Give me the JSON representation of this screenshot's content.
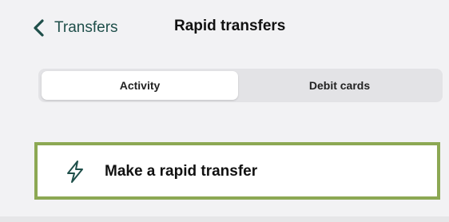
{
  "nav": {
    "back_label": "Transfers",
    "back_icon": "chevron-left-icon",
    "title": "Rapid transfers"
  },
  "tabs": [
    {
      "label": "Activity",
      "selected": true
    },
    {
      "label": "Debit cards",
      "selected": false
    }
  ],
  "action": {
    "icon": "lightning-bolt-icon",
    "label": "Make a rapid transfer"
  },
  "colors": {
    "accent_text": "#1f4f4a",
    "highlight_border": "#8ca853",
    "background": "#f2f2f4"
  }
}
